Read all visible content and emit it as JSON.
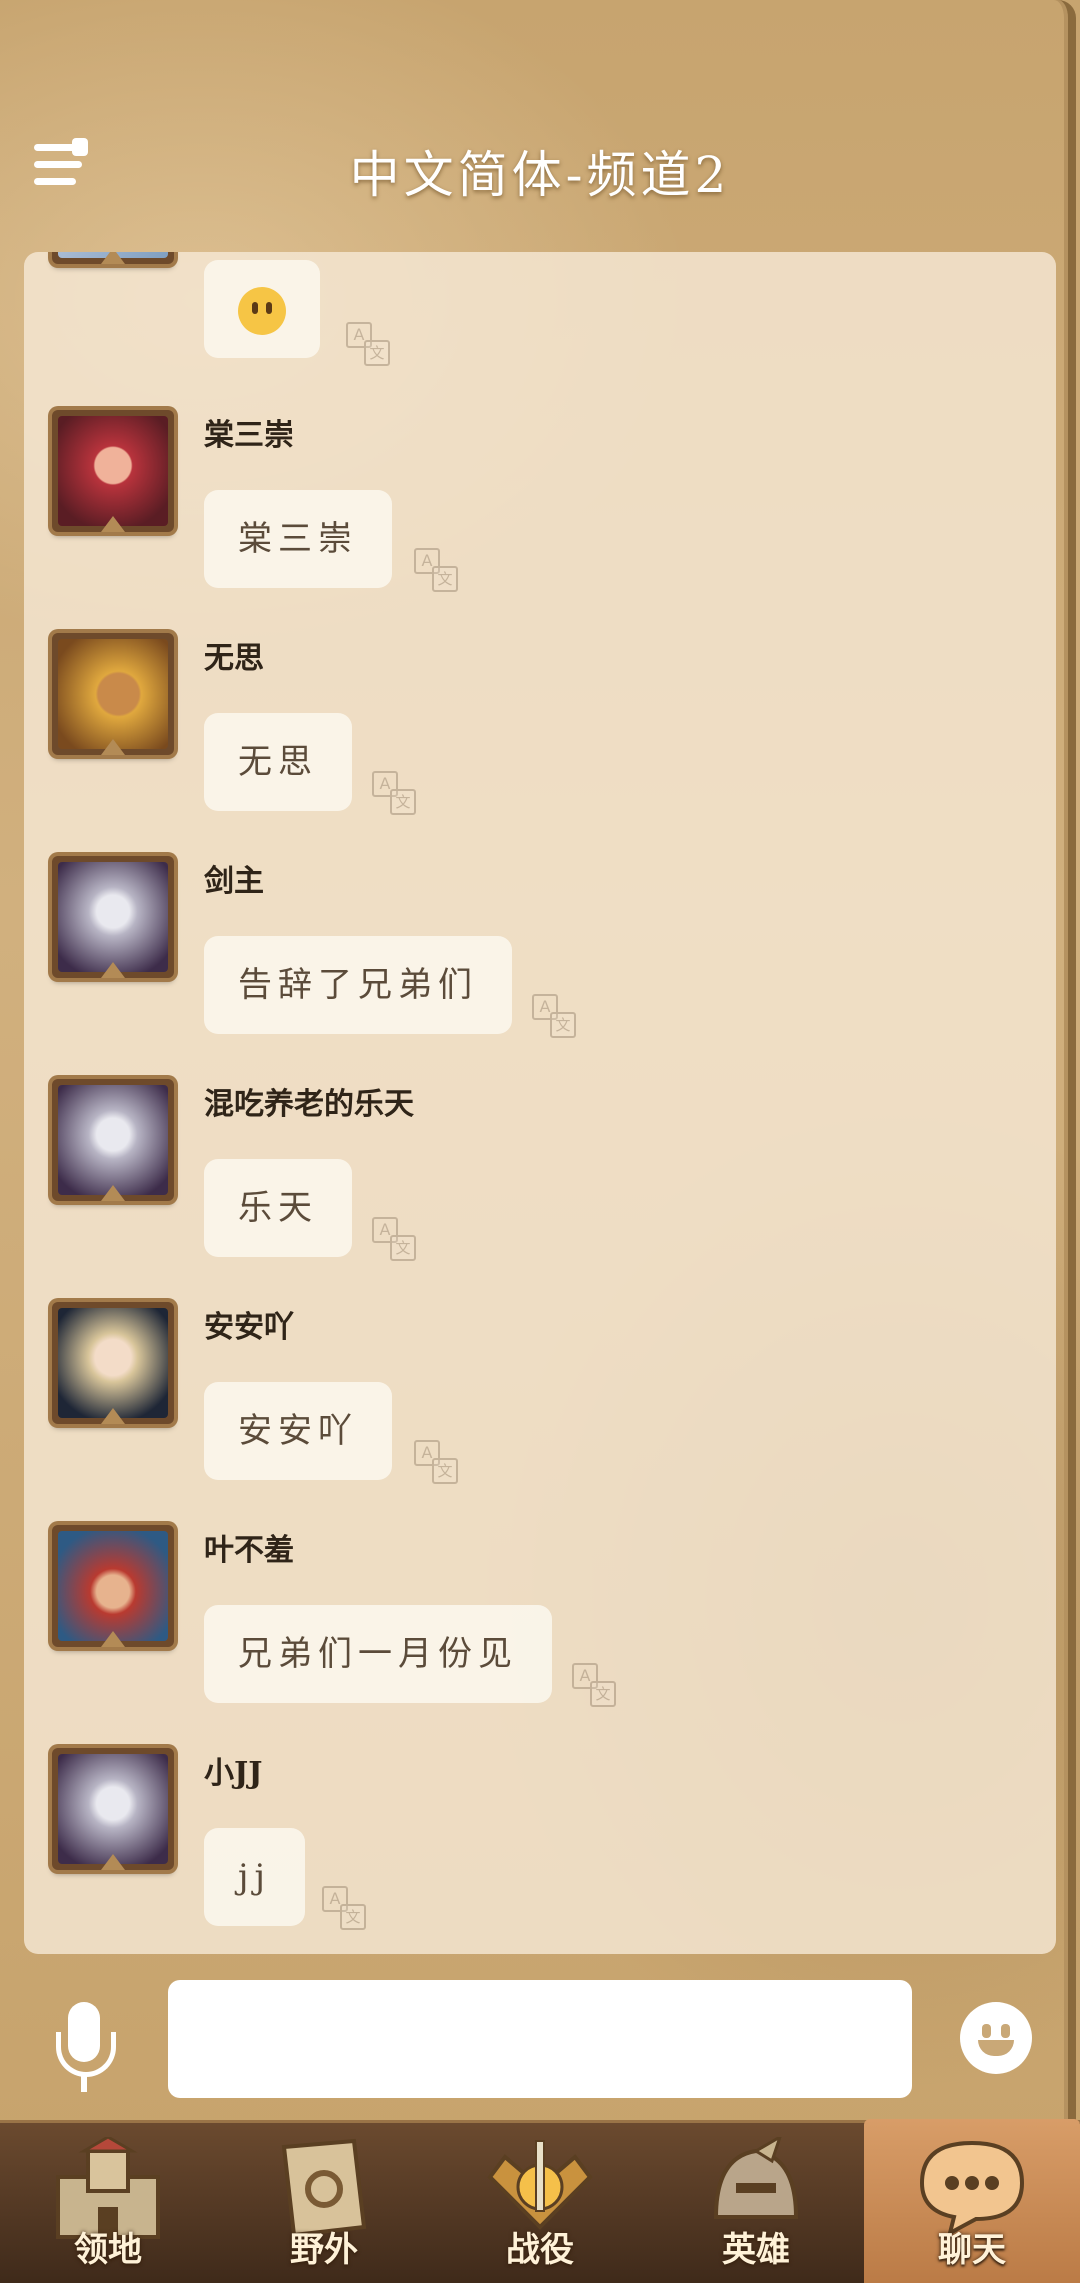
{
  "header": {
    "title": "中文简体-频道2"
  },
  "messages": [
    {
      "name": "",
      "text": "",
      "emoji": "neutral-face-emoji",
      "avatar_color": "#7f9fc1"
    },
    {
      "name": "棠三崇",
      "text": "棠三崇",
      "avatar_color": "#b8333c"
    },
    {
      "name": "无思",
      "text": "无思",
      "avatar_color": "#d1922e"
    },
    {
      "name": "剑主",
      "text": "告辞了兄弟们",
      "avatar_color": "#6d5b8c"
    },
    {
      "name": "混吃养老的乐天",
      "text": "乐天",
      "avatar_color": "#6d5b8c"
    },
    {
      "name": "安安吖",
      "text": "安安吖",
      "avatar_color": "#36455e"
    },
    {
      "name": "叶不羞",
      "text": "兄弟们一月份见",
      "avatar_color": "#2e5a84"
    },
    {
      "name": "小JJ",
      "text": "jj",
      "avatar_color": "#6d5b8c"
    }
  ],
  "translate_icon": {
    "a": "A",
    "zh": "文"
  },
  "input": {
    "value": "",
    "placeholder": ""
  },
  "nav": [
    {
      "label": "领地",
      "icon": "castle-icon"
    },
    {
      "label": "野外",
      "icon": "scroll-map-icon"
    },
    {
      "label": "战役",
      "icon": "sword-emblem-icon"
    },
    {
      "label": "英雄",
      "icon": "helmet-icon"
    },
    {
      "label": "聊天",
      "icon": "chat-bubble-icon",
      "active": true
    }
  ],
  "colors": {
    "accent": "#c9a877",
    "active_tab": "#d89d68",
    "panel": "#f5e8d4"
  }
}
